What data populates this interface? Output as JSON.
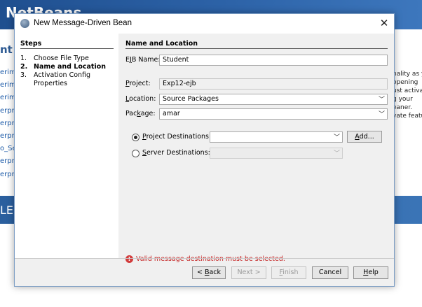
{
  "background": {
    "logo": "NetBeans",
    "left_title": "nt F",
    "left_items": [
      "erime",
      "erime",
      "erime",
      "erpris",
      "erpris",
      "erpris",
      "o_Se",
      "erpris",
      "erpris"
    ],
    "stripe_text": "LE",
    "right_lines": [
      "nality as y",
      "opening",
      "ust activa",
      "g your",
      "eaner.",
      "vate featu"
    ]
  },
  "dialog": {
    "title": "New Message-Driven Bean",
    "close_glyph": "✕"
  },
  "steps": {
    "title": "Steps",
    "items": [
      {
        "num": "1.",
        "label": "Choose File Type"
      },
      {
        "num": "2.",
        "label": "Name and Location"
      },
      {
        "num": "3.",
        "label": "Activation Config"
      },
      {
        "num": "",
        "label": "Properties"
      }
    ]
  },
  "form": {
    "section_title": "Name and Location",
    "ejb_name": {
      "pre": "E",
      "mnemonic": "J",
      "post": "B Name:",
      "value": "Student"
    },
    "project": {
      "pre": "",
      "mnemonic": "P",
      "post": "roject:",
      "value": "Exp12-ejb"
    },
    "location": {
      "pre": "",
      "mnemonic": "L",
      "post": "ocation:",
      "value": "Source Packages"
    },
    "package": {
      "pre": "Pac",
      "mnemonic": "k",
      "post": "age:",
      "value": "amar"
    },
    "project_dest": {
      "pre": "",
      "mnemonic": "P",
      "post": "roject Destinations:",
      "value": ""
    },
    "server_dest": {
      "pre": "",
      "mnemonic": "S",
      "post": "erver Destinations:",
      "value": ""
    },
    "add_button": {
      "pre": "",
      "mnemonic": "A",
      "post": "dd..."
    },
    "error": "Valid message destination must be selected.",
    "error_icon": "!"
  },
  "buttons": {
    "back": {
      "pre": "< ",
      "mnemonic": "B",
      "post": "ack"
    },
    "next": "Next >",
    "finish": {
      "pre": "",
      "mnemonic": "F",
      "post": "inish"
    },
    "cancel": "Cancel",
    "help": {
      "pre": "",
      "mnemonic": "H",
      "post": "elp"
    }
  },
  "arrow_glyph": "﹀",
  "colors": {
    "error": "#c62828",
    "banner": "#2d63a8",
    "dialog_bg": "#f0f0f0"
  }
}
